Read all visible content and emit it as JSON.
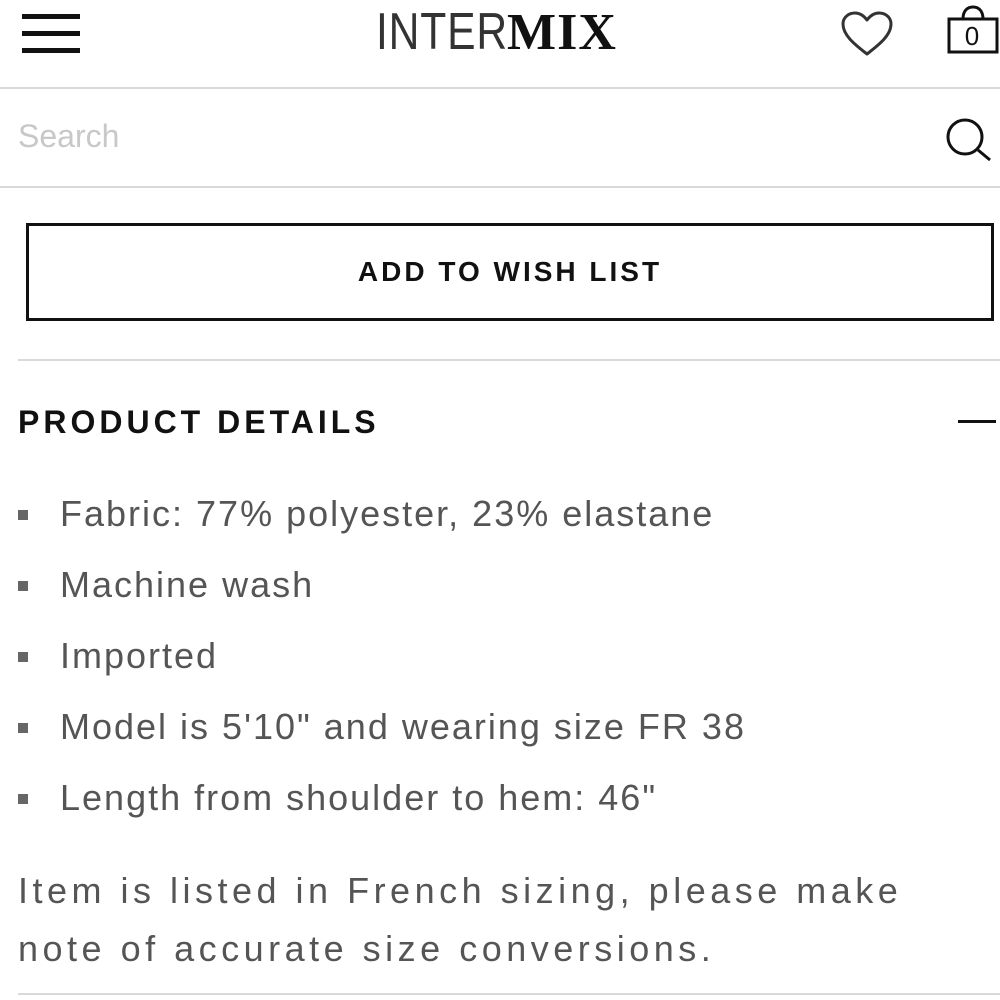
{
  "header": {
    "logo_light": "INTER",
    "logo_bold": "MIX",
    "bag_count": "0",
    "icons": {
      "menu": "hamburger-menu-icon",
      "wishlist": "heart-icon",
      "bag": "shopping-bag-icon"
    }
  },
  "search": {
    "placeholder": "Search",
    "value": "",
    "icon": "search-icon"
  },
  "wish_list": {
    "label": "ADD TO WISH LIST"
  },
  "product_details": {
    "heading": "PRODUCT DETAILS",
    "toggle_icon": "minus-icon",
    "items": [
      "Fabric: 77% polyester, 23% elastane",
      "Machine wash",
      "Imported",
      "Model is 5'10\" and wearing size FR 38",
      "Length from shoulder to hem: 46\""
    ],
    "note": "Item is listed in French sizing, please make note of accurate size conversions."
  },
  "colors": {
    "text_dark": "#111111",
    "text_body": "#555555",
    "placeholder": "#c8c8c8",
    "divider": "#d9d9d9"
  }
}
